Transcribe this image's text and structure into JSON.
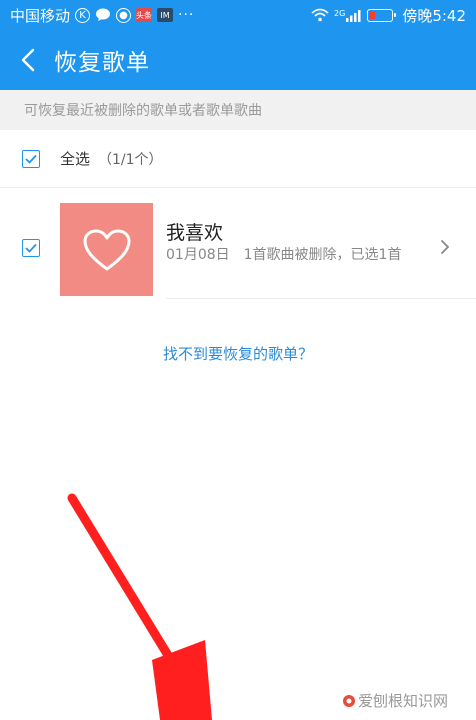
{
  "status_bar": {
    "carrier": "中国移动",
    "network_type": "2G",
    "time_label": "傍晚5:42",
    "badge_1": "头条",
    "badge_2": "IM",
    "more": "···"
  },
  "header": {
    "title": "恢复歌单"
  },
  "subheader": {
    "text": "可恢复最近被删除的歌单或者歌单歌曲"
  },
  "select_all": {
    "label": "全选",
    "count": "（1/1个）",
    "checked": true
  },
  "playlist": {
    "name": "我喜欢",
    "description": "01月08日　1首歌曲被删除，已选1首",
    "checked": true
  },
  "link": {
    "text": "找不到要恢复的歌单？"
  },
  "watermark": {
    "text": "爱刨根知识网"
  },
  "colors": {
    "accent": "#1e96f0",
    "cover": "#f28b83",
    "link": "#2a8bd8",
    "arrow": "#ff1f1f"
  }
}
